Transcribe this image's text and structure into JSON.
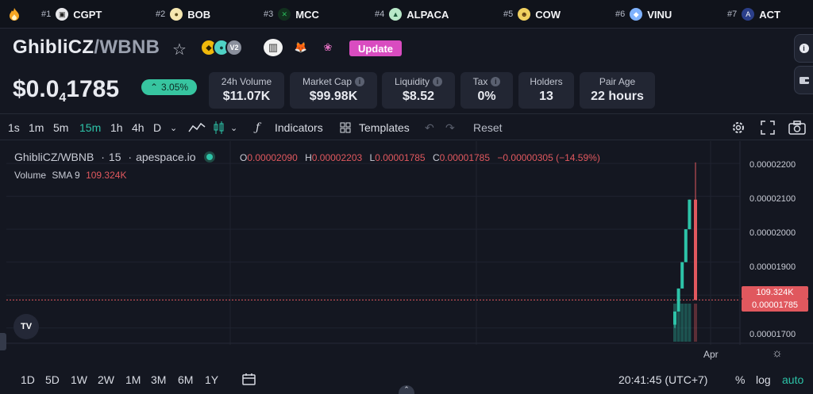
{
  "ticker": [
    {
      "rank": "#1",
      "symbol": "CGPT",
      "icon": "cgpt-icon",
      "color": "#ffffff"
    },
    {
      "rank": "#2",
      "symbol": "BOB",
      "icon": "bob-icon",
      "color": "#f5e7b0"
    },
    {
      "rank": "#3",
      "symbol": "MCC",
      "icon": "mcc-icon",
      "color": "#2ab85a"
    },
    {
      "rank": "#4",
      "symbol": "ALPACA",
      "icon": "alpaca-icon",
      "color": "#b8e8c8"
    },
    {
      "rank": "#5",
      "symbol": "COW",
      "icon": "cow-icon",
      "color": "#f0d060"
    },
    {
      "rank": "#6",
      "symbol": "VINU",
      "icon": "vinu-icon",
      "color": "#7fb2ff"
    },
    {
      "rank": "#7",
      "symbol": "ACT",
      "icon": "act-icon",
      "color": "#2b3f8a"
    }
  ],
  "header": {
    "base": "GhibliCZ",
    "quote": "/WBNB",
    "version_badge": "V2",
    "update_label": "Update"
  },
  "price": {
    "prefix": "$0.0",
    "zeros": "4",
    "digits": "1785",
    "change": "3.05%"
  },
  "stats": [
    {
      "label": "24h Volume",
      "value": "$11.07K",
      "info": false
    },
    {
      "label": "Market Cap",
      "value": "$99.98K",
      "info": true
    },
    {
      "label": "Liquidity",
      "value": "$8.52",
      "info": true
    },
    {
      "label": "Tax",
      "value": "0%",
      "info": true
    },
    {
      "label": "Holders",
      "value": "13",
      "info": false
    },
    {
      "label": "Pair Age",
      "value": "22 hours",
      "info": false
    }
  ],
  "toolbar": {
    "intervals": [
      "1s",
      "1m",
      "5m",
      "15m",
      "1h",
      "4h",
      "D"
    ],
    "active_interval": "15m",
    "indicators_label": "Indicators",
    "templates_label": "Templates",
    "reset_label": "Reset"
  },
  "chart_legend": {
    "pair": "GhibliCZ/WBNB",
    "interval": "15",
    "source": "apespace.io",
    "o_label": "O",
    "o": "0.00002090",
    "h_label": "H",
    "h": "0.00002203",
    "l_label": "L",
    "l": "0.00001785",
    "c_label": "C",
    "c": "0.00001785",
    "chg": "−0.00000305 (−14.59%)",
    "volume_label": "Volume",
    "sma_label": "SMA 9",
    "volume_value": "109.324K"
  },
  "chart_data": {
    "type": "candlestick",
    "y_ticks": [
      "0.00002200",
      "0.00002100",
      "0.00002000",
      "0.00001900",
      "0.00001700"
    ],
    "ylim": [
      1.68e-05,
      2.21e-05
    ],
    "x_tick": "Apr",
    "volume_tag": "109.324K",
    "price_tag": "0.00001785",
    "candles": [
      {
        "o": 1.71e-05,
        "h": 1.75e-05,
        "l": 1.7e-05,
        "c": 1.75e-05,
        "color": "up"
      },
      {
        "o": 1.75e-05,
        "h": 1.82e-05,
        "l": 1.75e-05,
        "c": 1.82e-05,
        "color": "up"
      },
      {
        "o": 1.82e-05,
        "h": 1.9e-05,
        "l": 1.82e-05,
        "c": 1.9e-05,
        "color": "up"
      },
      {
        "o": 1.9e-05,
        "h": 2e-05,
        "l": 1.9e-05,
        "c": 2e-05,
        "color": "up"
      },
      {
        "o": 2e-05,
        "h": 2.09e-05,
        "l": 2e-05,
        "c": 2.09e-05,
        "color": "up"
      },
      {
        "o": 2.09e-05,
        "h": 2.203e-05,
        "l": 1.785e-05,
        "c": 1.785e-05,
        "color": "down"
      }
    ]
  },
  "bottom": {
    "ranges": [
      "1D",
      "5D",
      "1W",
      "2W",
      "1M",
      "3M",
      "6M",
      "1Y"
    ],
    "time": "20:41:45 (UTC+7)",
    "percent": "%",
    "log": "log",
    "auto": "auto"
  },
  "colors": {
    "up": "#2dc3a8",
    "down": "#e0585e",
    "accent": "#d94cc0"
  }
}
